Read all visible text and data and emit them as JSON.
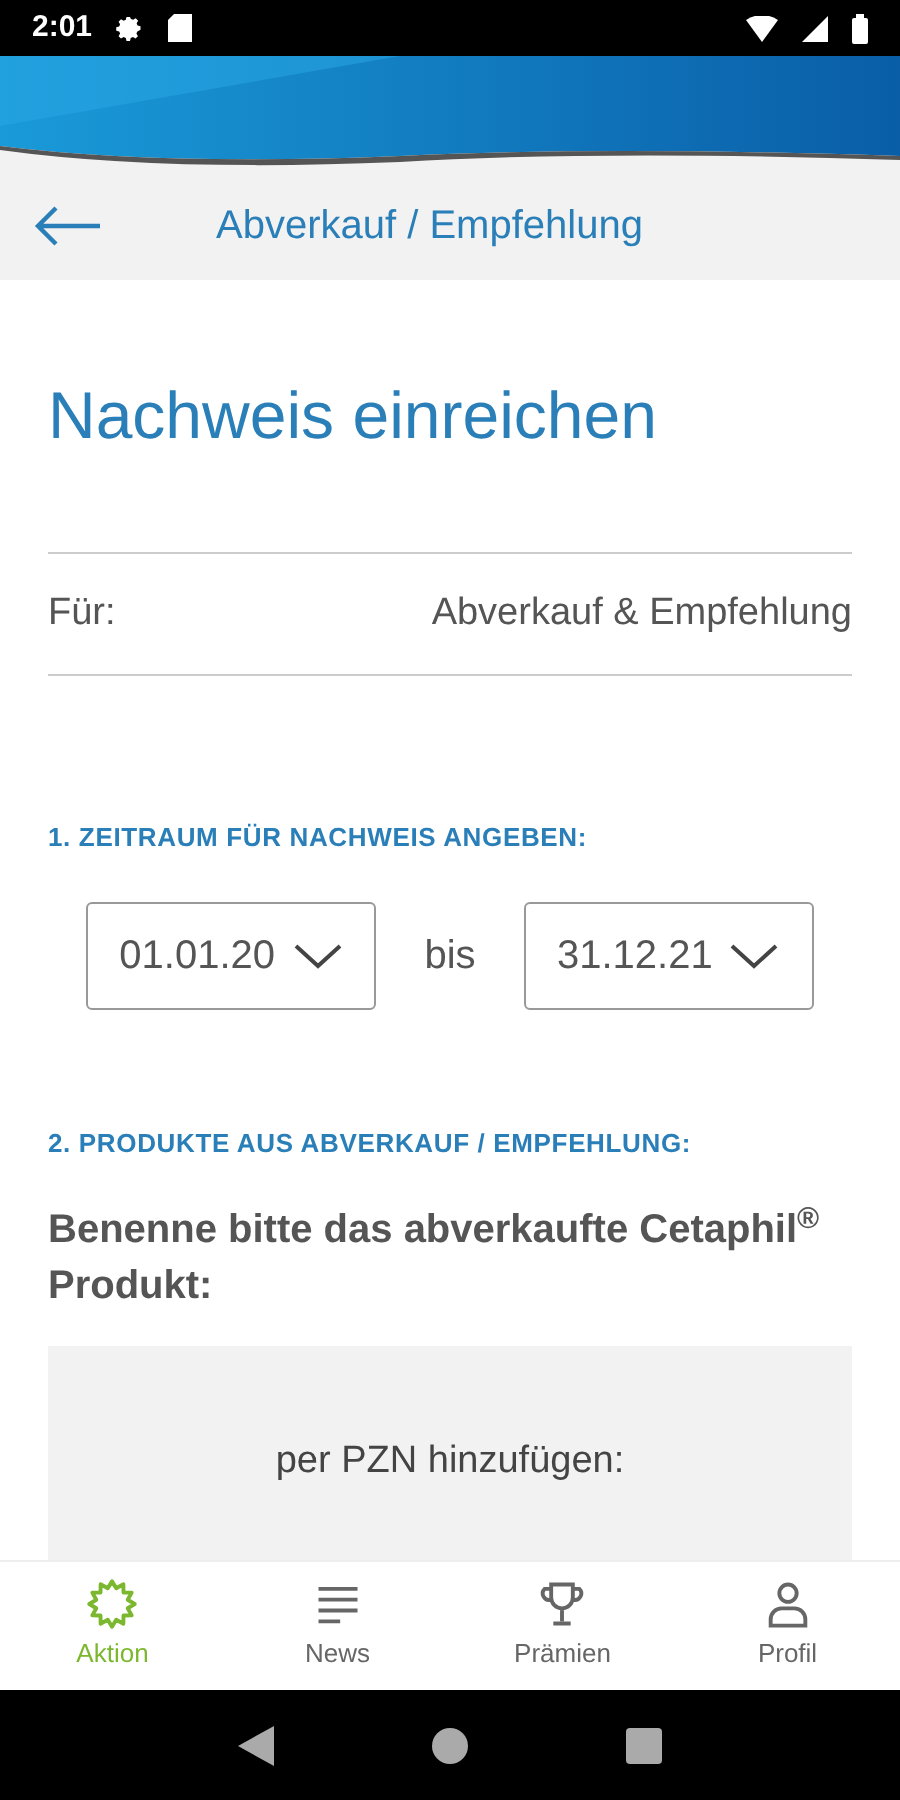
{
  "status_bar": {
    "time": "2:01"
  },
  "header": {
    "title": "Abverkauf / Empfehlung"
  },
  "page_title": "Nachweis einreichen",
  "for_row": {
    "label": "Für:",
    "value": "Abverkauf & Empfehlung"
  },
  "section_1": {
    "heading": "1. ZEITRAUM FÜR NACHWEIS ANGEBEN:",
    "from": "01.01.20",
    "separator": "bis",
    "to": "31.12.21"
  },
  "section_2": {
    "heading": "2. PRODUKTE AUS ABVERKAUF / EMPFEHLUNG:",
    "question": "Benenne bitte das abverkaufte Cetaphil$^{®}$ Produkt:",
    "add_label": "per PZN hinzufügen:"
  },
  "bottom_nav": [
    {
      "kind": "sun",
      "label": "Aktion",
      "selected": true
    },
    {
      "kind": "lines",
      "label": "News",
      "selected": false
    },
    {
      "kind": "trophy",
      "label": "Prämien",
      "selected": false
    },
    {
      "kind": "person",
      "label": "Profil",
      "selected": false
    }
  ]
}
